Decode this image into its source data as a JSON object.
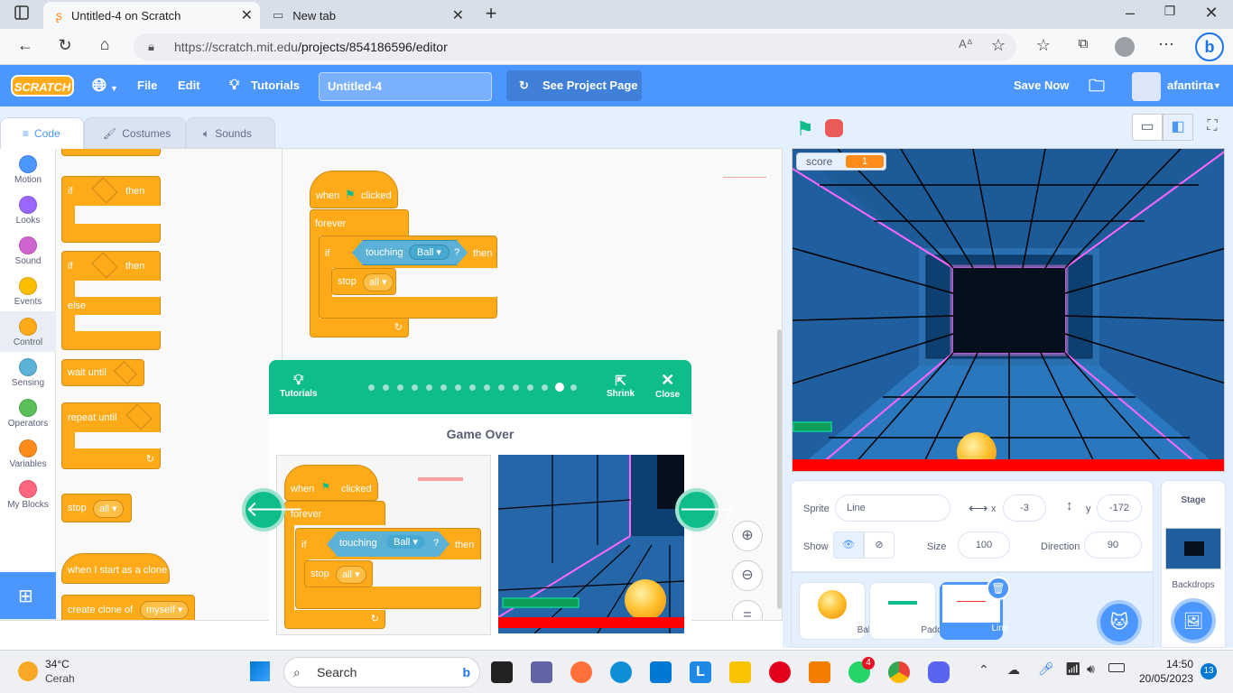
{
  "browser": {
    "tabs": [
      {
        "title": "Untitled-4 on Scratch",
        "active": true
      },
      {
        "title": "New tab",
        "active": false
      }
    ],
    "url_prefix": "https://scratch.mit.edu",
    "url_path": "/projects/854186596/editor"
  },
  "menubar": {
    "logo": "SCRATCH",
    "file": "File",
    "edit": "Edit",
    "tutorials": "Tutorials",
    "project_title": "Untitled-4",
    "see_project": "See Project Page",
    "save_now": "Save Now",
    "username": "afantirta",
    "color": "#4c97ff"
  },
  "editor_tabs": {
    "code": "Code",
    "costumes": "Costumes",
    "sounds": "Sounds"
  },
  "categories": [
    {
      "label": "Motion",
      "color": "#4c97ff"
    },
    {
      "label": "Looks",
      "color": "#9966ff"
    },
    {
      "label": "Sound",
      "color": "#cf63cf"
    },
    {
      "label": "Events",
      "color": "#ffbf00"
    },
    {
      "label": "Control",
      "color": "#ffab19"
    },
    {
      "label": "Sensing",
      "color": "#5cb1d6"
    },
    {
      "label": "Operators",
      "color": "#59c059"
    },
    {
      "label": "Variables",
      "color": "#ff8c1a"
    },
    {
      "label": "My Blocks",
      "color": "#ff6680"
    }
  ],
  "palette": {
    "if": "if",
    "then": "then",
    "else": "else",
    "wait_until": "wait until",
    "repeat_until": "repeat until",
    "stop": "stop",
    "stop_opt": "all",
    "when_clone": "when I start as a clone",
    "create_clone": "create clone of",
    "create_clone_opt": "myself"
  },
  "script": {
    "when": "when",
    "clicked": "clicked",
    "forever": "forever",
    "if": "if",
    "touching": "touching",
    "ball": "Ball",
    "q": "?",
    "then": "then",
    "stop": "stop",
    "all": "all"
  },
  "tutorial": {
    "tutorials_label": "Tutorials",
    "shrink_label": "Shrink",
    "close_label": "Close",
    "step_title": "Game Over",
    "total_steps": 15,
    "current_step": 14
  },
  "stage": {
    "score_label": "score",
    "score_value": "1"
  },
  "sprite_info": {
    "sprite_label": "Sprite",
    "sprite_name": "Line",
    "x_label": "x",
    "x_value": "-3",
    "y_label": "y",
    "y_value": "-172",
    "show_label": "Show",
    "size_label": "Size",
    "size_value": "100",
    "direction_label": "Direction",
    "direction_value": "90"
  },
  "sprites": [
    {
      "name": "Ball"
    },
    {
      "name": "Paddle"
    },
    {
      "name": "Line"
    }
  ],
  "stage_panel": {
    "title": "Stage",
    "backdrops": "Backdrops"
  },
  "taskbar": {
    "temp": "34°C",
    "weather": "Cerah",
    "search": "Search",
    "time": "14:50",
    "date": "20/05/2023",
    "notif_count": "13",
    "whatsapp_badge": "4"
  }
}
